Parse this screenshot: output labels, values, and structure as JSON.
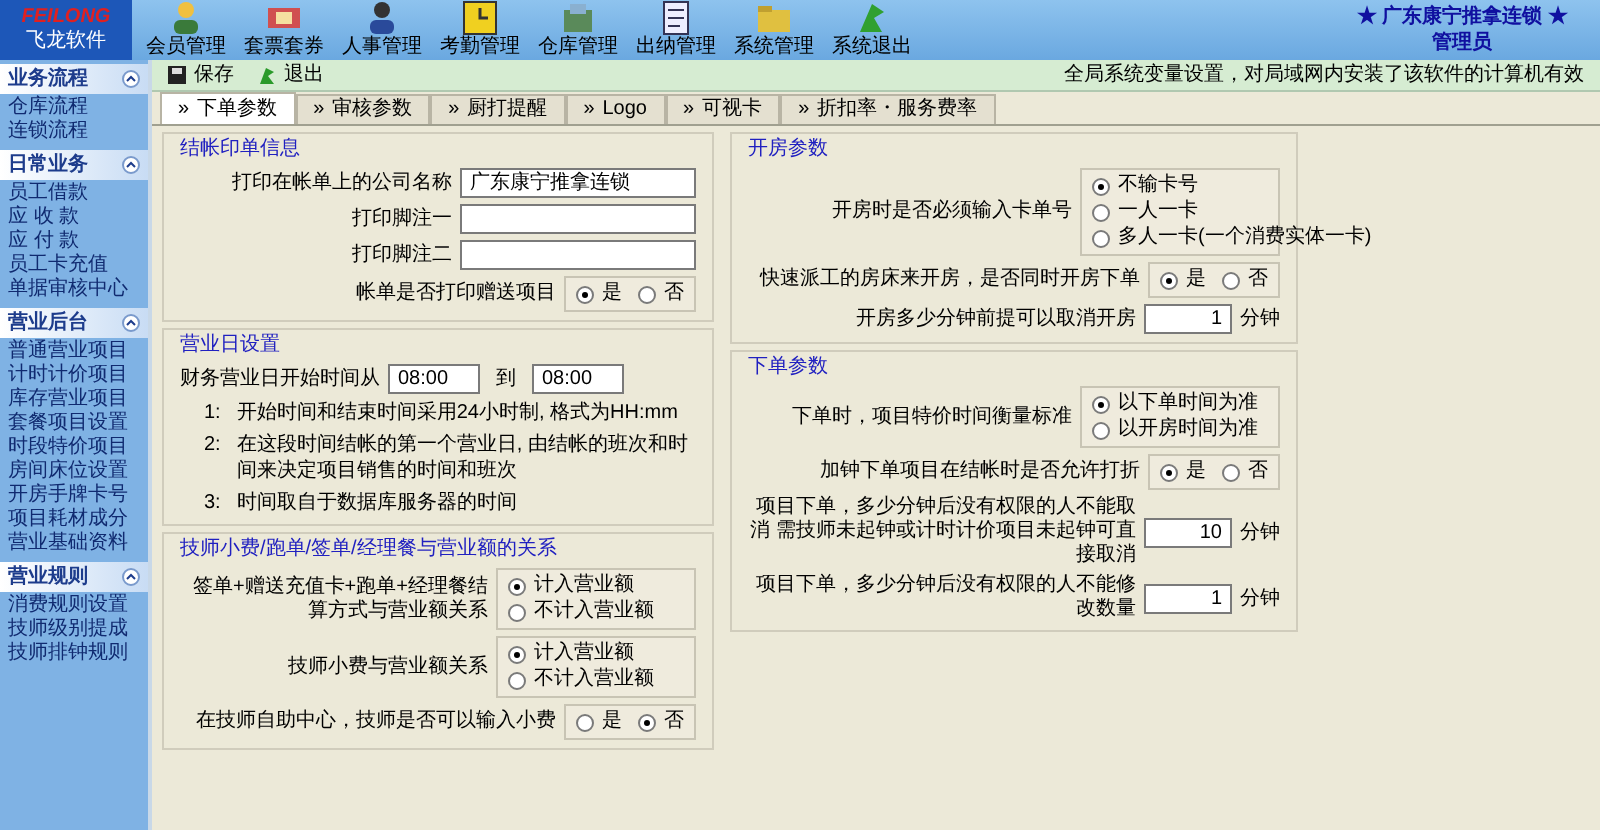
{
  "logo": {
    "title": "FEILONG",
    "subtitle": "飞龙软件"
  },
  "nav": [
    {
      "label": "会员管理"
    },
    {
      "label": "套票套券"
    },
    {
      "label": "人事管理"
    },
    {
      "label": "考勤管理"
    },
    {
      "label": "仓库管理"
    },
    {
      "label": "出纳管理"
    },
    {
      "label": "系统管理"
    },
    {
      "label": "系统退出"
    }
  ],
  "company": {
    "name": "★ 广东康宁推拿连锁 ★",
    "user": "管理员"
  },
  "sidebar": [
    {
      "title": "业务流程",
      "items": [
        "仓库流程",
        "连锁流程"
      ]
    },
    {
      "title": "日常业务",
      "items": [
        "员工借款",
        "应 收 款",
        "应 付 款",
        "员工卡充值",
        "单据审核中心"
      ]
    },
    {
      "title": "营业后台",
      "items": [
        "普通营业项目",
        "计时计价项目",
        "库存营业项目",
        "套餐项目设置",
        "时段特价项目",
        "房间床位设置",
        "开房手牌卡号",
        "项目耗材成分",
        "营业基础资料"
      ]
    },
    {
      "title": "营业规则",
      "items": [
        "消费规则设置",
        "技师级别提成",
        "技师排钟规则"
      ]
    }
  ],
  "toolbar": {
    "buttons": [
      "保存",
      "退出"
    ],
    "note": "全局系统变量设置，对局域网内安装了该软件的计算机有效"
  },
  "tabs": [
    {
      "marker": "»",
      "label": "下单参数",
      "selected": true
    },
    {
      "marker": "»",
      "label": "审核参数",
      "selected": false
    },
    {
      "marker": "»",
      "label": "厨打提醒",
      "selected": false
    },
    {
      "marker": "»",
      "label": "Logo",
      "selected": false
    },
    {
      "marker": "»",
      "label": "可视卡",
      "selected": false
    },
    {
      "marker": "»",
      "label": "折扣率・服务费率",
      "selected": false
    }
  ],
  "left_column": [
    {
      "title": "结帐印单信息",
      "rows": [
        {
          "kind": "text-field",
          "label": "打印在帐单上的公司名称",
          "value": "广东康宁推拿连锁"
        },
        {
          "kind": "text-field",
          "label": "打印脚注一"
        },
        {
          "kind": "text-field",
          "label": "打印脚注二"
        },
        {
          "kind": "radio-inline",
          "label": "帐单是否打印赠送项目",
          "options": [
            {
              "label": "是",
              "selected": true
            },
            {
              "label": "否",
              "selected": false
            }
          ]
        }
      ]
    },
    {
      "title": "营业日设置",
      "rows": [
        {
          "kind": "time-range",
          "label": "财务营业日开始时间从",
          "from": "08:00",
          "connector": "到",
          "to": "08:00"
        },
        {
          "kind": "note",
          "number": "1:",
          "text": "开始时间和结束时间采用24小时制, 格式为HH:mm"
        },
        {
          "kind": "note",
          "number": "2:",
          "text": "在这段时间结帐的第一个营业日, 由结帐的班次和时间来决定项目销售的时间和班次"
        },
        {
          "kind": "note",
          "number": "3:",
          "text": "时间取自于数据库服务器的时间"
        }
      ]
    },
    {
      "title": "技师小费/跑单/签单/经理餐与营业额的关系",
      "rows": [
        {
          "kind": "radio-stack",
          "label": "签单+赠送充值卡+跑单+经理餐结算方式与营业额关系",
          "options": [
            {
              "label": "计入营业额",
              "selected": true
            },
            {
              "label": "不计入营业额",
              "selected": false
            }
          ]
        },
        {
          "kind": "radio-stack",
          "label": "技师小费与营业额关系",
          "options": [
            {
              "label": "计入营业额",
              "selected": true
            },
            {
              "label": "不计入营业额",
              "selected": false
            }
          ]
        },
        {
          "kind": "radio-inline",
          "label": "在技师自助中心，技师是否可以输入小费",
          "options": [
            {
              "label": "是",
              "selected": false
            },
            {
              "label": "否",
              "selected": true
            }
          ]
        }
      ]
    }
  ],
  "right_column": [
    {
      "title": "开房参数",
      "rows": [
        {
          "kind": "radio-stack",
          "label": "开房时是否必须输入卡单号",
          "options": [
            {
              "label": "不输卡号",
              "selected": true
            },
            {
              "label": "一人一卡",
              "selected": false
            },
            {
              "label": "多人一卡(一个消费实体一卡)",
              "selected": false
            }
          ]
        },
        {
          "kind": "radio-inline",
          "label": "快速派工的房床来开房，是否同时开房下单",
          "options": [
            {
              "label": "是",
              "selected": true
            },
            {
              "label": "否",
              "selected": false
            }
          ]
        },
        {
          "kind": "number-field",
          "label": "开房多少分钟前提可以取消开房",
          "value": "1",
          "unit": "分钟"
        }
      ]
    },
    {
      "title": "下单参数",
      "rows": [
        {
          "kind": "radio-stack",
          "label": "下单时，项目特价时间衡量标准",
          "options": [
            {
              "label": "以下单时间为准",
              "selected": true
            },
            {
              "label": "以开房时间为准",
              "selected": false
            }
          ]
        },
        {
          "kind": "radio-inline",
          "label": "加钟下单项目在结帐时是否允许打折",
          "options": [
            {
              "label": "是",
              "selected": true
            },
            {
              "label": "否",
              "selected": false
            }
          ]
        },
        {
          "kind": "number-field",
          "label": "项目下单，多少分钟后没有权限的人不能取消 需技师未起钟或计时计价项目未起钟可直接取消",
          "value": "10",
          "unit": "分钟"
        },
        {
          "kind": "number-field",
          "label": "项目下单，多少分钟后没有权限的人不能修改数量",
          "value": "1",
          "unit": "分钟"
        }
      ]
    }
  ]
}
